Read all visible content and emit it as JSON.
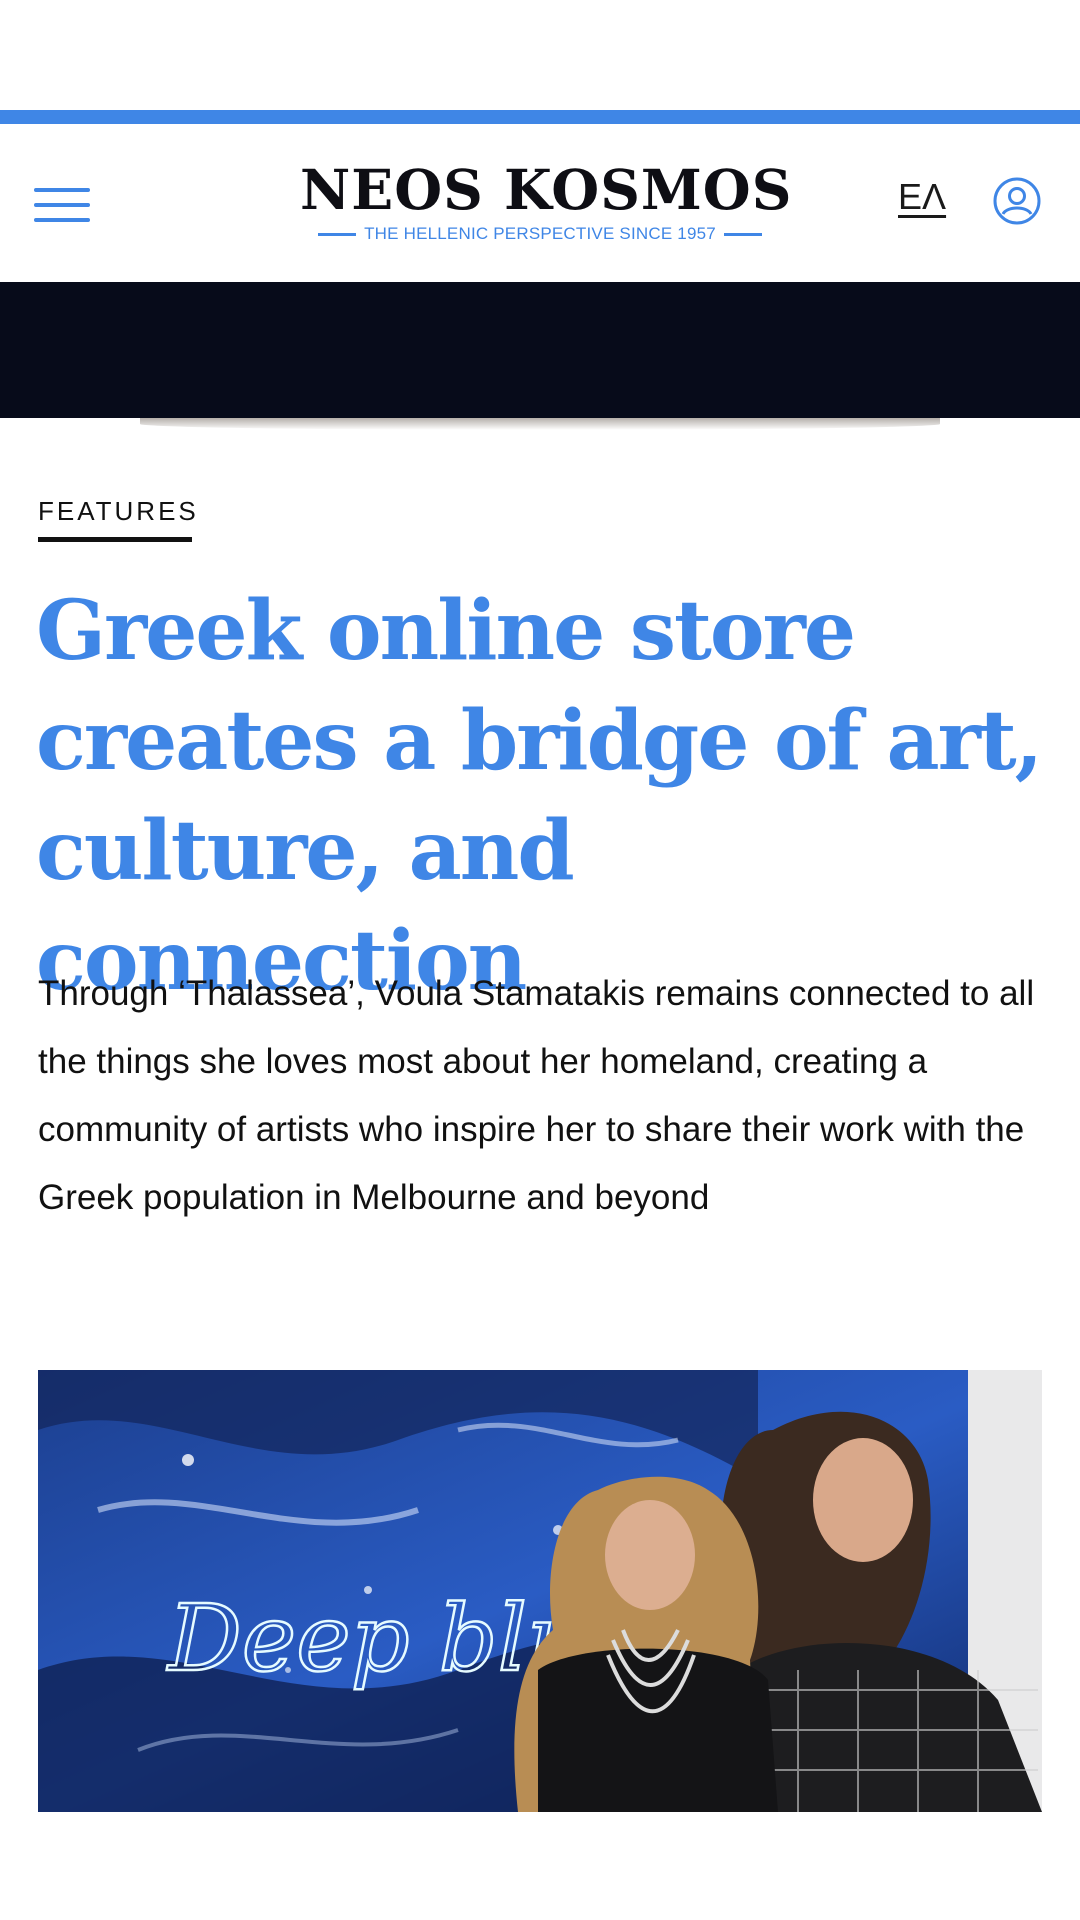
{
  "header": {
    "brand_name": "NEOS KOSMOS",
    "tagline": "THE HELLENIC PERSPECTIVE SINCE 1957",
    "language_toggle": "ΕΛ",
    "menu_icon": "hamburger-menu-icon",
    "account_icon": "user-account-icon"
  },
  "colors": {
    "accent": "#3f86e6",
    "text": "#111111",
    "hero_band": "#070b1a"
  },
  "article": {
    "category": "FEATURES",
    "headline": "Greek online store creates a bridge of art, culture, and connection",
    "standfirst": "Through ‘Thalassea’, Voula Stamatakis remains connected to all the things she loves most about her homeland, creating a community of artists who inspire her to share their work with the Greek population in Melbourne and beyond",
    "image_sign_text": "Deep blue"
  }
}
